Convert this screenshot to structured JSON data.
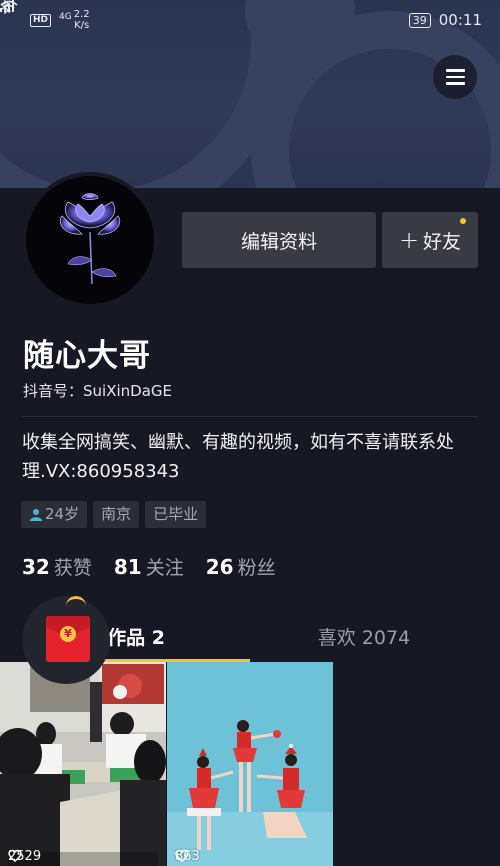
{
  "status_bar": {
    "hd": "HD",
    "network": "4G",
    "speed_value": "2.2",
    "speed_unit": "K/s",
    "battery": "39",
    "time": "00:11"
  },
  "profile": {
    "nickname": "随心大哥",
    "douyin_id": "抖音号：SuiXinDaGE",
    "bio": "收集全网搞笑、幽默、有趣的视频，如有不喜请联系处理.VX:860958343",
    "edit_label": "编辑资料",
    "friend_label": "好友",
    "tags": [
      {
        "label": "24岁",
        "icon": "person-icon"
      },
      {
        "label": "南京"
      },
      {
        "label": "已毕业"
      }
    ]
  },
  "stats": [
    {
      "count": "32",
      "label": "获赞"
    },
    {
      "count": "81",
      "label": "关注"
    },
    {
      "count": "26",
      "label": "粉丝"
    }
  ],
  "tabs": {
    "works": "作品 2",
    "likes": "喜欢 2074"
  },
  "videos": [
    {
      "plays": "2529"
    },
    {
      "plays": "863"
    }
  ],
  "colors": {
    "background": "#161823",
    "accent": "#f5c331",
    "button": "#393b44"
  }
}
